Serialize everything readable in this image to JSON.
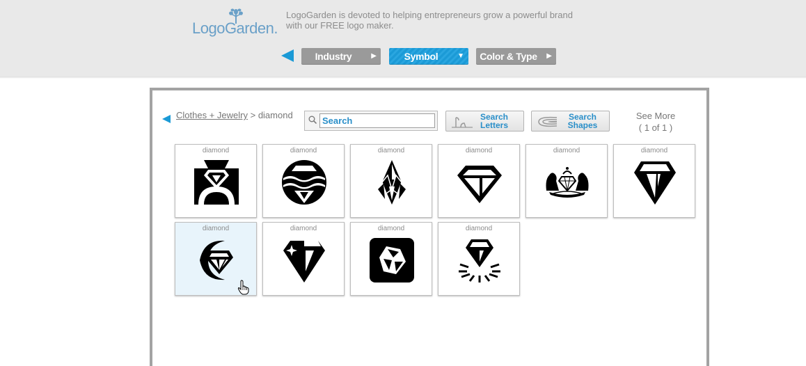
{
  "header": {
    "logo_text": "LogoGarden.",
    "tagline": "LogoGarden is devoted to helping entrepreneurs grow a powerful brand with our FREE logo maker."
  },
  "nav": {
    "steps": [
      {
        "label": "Industry",
        "arrow": "▶",
        "active": false
      },
      {
        "label": "Symbol",
        "arrow": "▼",
        "active": true
      },
      {
        "label": "Color & Type",
        "arrow": "▶",
        "active": false
      }
    ],
    "colors": {
      "active": "#1b9ad6",
      "inactive": "#9a9a9a"
    }
  },
  "breadcrumb": {
    "parent": "Clothes + Jewelry",
    "separator": ">",
    "current": "diamond"
  },
  "search": {
    "placeholder": "Search",
    "value": ""
  },
  "tools": {
    "letters_line1": "Search",
    "letters_line2": "Letters",
    "shapes_line1": "Search",
    "shapes_line2": "Shapes"
  },
  "pagination": {
    "label": "See More",
    "status": "( 1 of 1 )"
  },
  "symbols": [
    {
      "caption": "diamond",
      "icon": "diamond-ring-square-icon"
    },
    {
      "caption": "diamond",
      "icon": "diamond-circle-waves-icon"
    },
    {
      "caption": "diamond",
      "icon": "diamond-crystal-shards-icon"
    },
    {
      "caption": "diamond",
      "icon": "diamond-outline-icon"
    },
    {
      "caption": "diamond",
      "icon": "diamond-crest-lions-icon"
    },
    {
      "caption": "diamond",
      "icon": "diamond-faceted-icon"
    },
    {
      "caption": "diamond",
      "icon": "diamond-crescent-icon",
      "hovered": true
    },
    {
      "caption": "diamond",
      "icon": "diamond-sparkle-icon"
    },
    {
      "caption": "diamond",
      "icon": "gem-rounded-square-icon"
    },
    {
      "caption": "diamond",
      "icon": "diamond-burst-icon"
    }
  ]
}
